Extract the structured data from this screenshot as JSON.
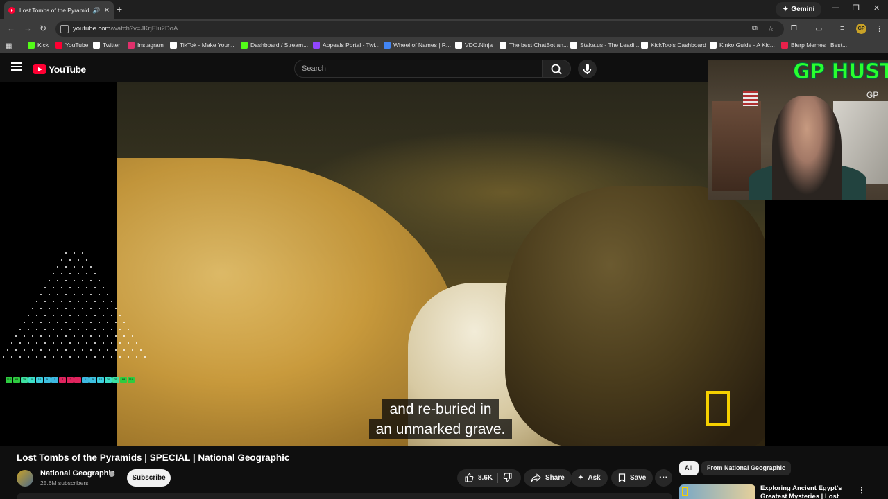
{
  "browser": {
    "tab_title": "Lost Tombs of the Pyramids",
    "new_tab": "+",
    "gemini_label": "Gemini",
    "url_main": "youtube.com",
    "url_rest": "/watch?v=JKrjElu2DoA",
    "profile_initials": "GP"
  },
  "bookmarks": [
    {
      "label": "Kick",
      "color": "#53fc18"
    },
    {
      "label": "YouTube",
      "color": "#ff0033"
    },
    {
      "label": "Twitter",
      "color": "#ffffff"
    },
    {
      "label": "Instagram",
      "color": "#e1306c"
    },
    {
      "label": "TikTok - Make Your...",
      "color": "#ffffff"
    },
    {
      "label": "Dashboard / Stream...",
      "color": "#53fc18"
    },
    {
      "label": "Appeals Portal - Twi...",
      "color": "#9146ff"
    },
    {
      "label": "Wheel of Names | R...",
      "color": "#4285f4"
    },
    {
      "label": "VDO.Ninja",
      "color": "#ffffff"
    },
    {
      "label": "The best ChatBot an...",
      "color": "#ffffff"
    },
    {
      "label": "Stake.us - The Leadi...",
      "color": "#ffffff"
    },
    {
      "label": "KickTools Dashboard",
      "color": "#ffffff"
    },
    {
      "label": "Kinko Guide - A Kic...",
      "color": "#ffffff"
    },
    {
      "label": "Blerp Memes | Best...",
      "color": "#e8214b"
    }
  ],
  "youtube": {
    "logo_text": "YouTube",
    "search_placeholder": "Search"
  },
  "video": {
    "subtitle_line1": "and re-buried in",
    "subtitle_line2": "an unmarked grave."
  },
  "overlay": {
    "webcam_title": "GP HUSTLA",
    "webcam_logo": "GP",
    "plinko_multipliers": [
      {
        "v": "110",
        "c": "#2ecc40"
      },
      {
        "v": "88",
        "c": "#2ecc40"
      },
      {
        "v": "25",
        "c": "#3de0a0"
      },
      {
        "v": "20",
        "c": "#3de0c8"
      },
      {
        "v": "10",
        "c": "#3dd0e0"
      },
      {
        "v": "5",
        "c": "#3dc0e0"
      },
      {
        "v": "1",
        "c": "#3db8e0"
      },
      {
        "v": "-1",
        "c": "#e0245e"
      },
      {
        "v": "-2",
        "c": "#e0245e"
      },
      {
        "v": "-1",
        "c": "#e0245e"
      },
      {
        "v": "1",
        "c": "#3db8e0"
      },
      {
        "v": "5",
        "c": "#3dc0e0"
      },
      {
        "v": "10",
        "c": "#3dd0e0"
      },
      {
        "v": "20",
        "c": "#3de0c8"
      },
      {
        "v": "25",
        "c": "#3de0a0"
      },
      {
        "v": "88",
        "c": "#2ecc40"
      },
      {
        "v": "110",
        "c": "#2ecc40"
      }
    ]
  },
  "details": {
    "title": "Lost Tombs of the Pyramids | SPECIAL | National Geographic",
    "channel": "National Geographic",
    "subscribers": "25.6M subscribers",
    "subscribe_label": "Subscribe",
    "likes": "8.6K",
    "share_label": "Share",
    "ask_label": "Ask",
    "save_label": "Save"
  },
  "sidebar": {
    "chip_all": "All",
    "chip_channel": "From National Geographic",
    "rec_title": "Exploring Ancient Egypt's Greatest Mysteries | Lost"
  }
}
